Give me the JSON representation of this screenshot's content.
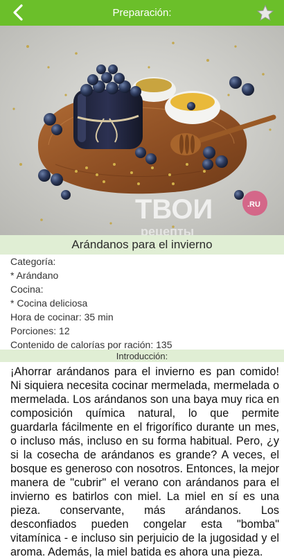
{
  "header": {
    "title": "Preparación:",
    "back_icon": "chevron-left-icon",
    "favorite_icon": "star-icon",
    "bar_color": "#6bbf2a"
  },
  "hero": {
    "watermark": "ТВОИ",
    "watermark_sub": "рецепты",
    "badge": ".RU"
  },
  "recipe": {
    "title": "Arándanos para el invierno"
  },
  "details": {
    "category_label": "Categoría:",
    "category_value": "* Arándano",
    "cuisine_label": "Cocina:",
    "cuisine_value": "* Cocina deliciosa",
    "cook_time": "Hora de cocinar: 35 min",
    "portions": "Porciones: 12",
    "calories": "Contenido de calorías por ración: 135"
  },
  "intro": {
    "header": "Introducción:",
    "text": "¡Ahorrar arándanos para el invierno es pan comido! Ni siquiera necesita cocinar mermelada, mermelada o mermelada. Los arándanos son una baya muy rica en composición química natural, lo que permite guardarla fácilmente en el frigorífico durante un mes, o incluso más, incluso en su forma habitual. Pero, ¿y si la cosecha de arándanos es grande? A veces, el bosque es generoso con nosotros. Entonces, la mejor manera de \"cubrir\" el verano con arándanos para el invierno es batirlos con miel. La miel en sí es una pieza. conservante, más arándanos. Los desconfiados pueden congelar esta \"bomba\" vitamínica - e incluso sin perjuicio de la jugosidad y el aroma. Además, la miel batida es ahora una pieza."
  }
}
